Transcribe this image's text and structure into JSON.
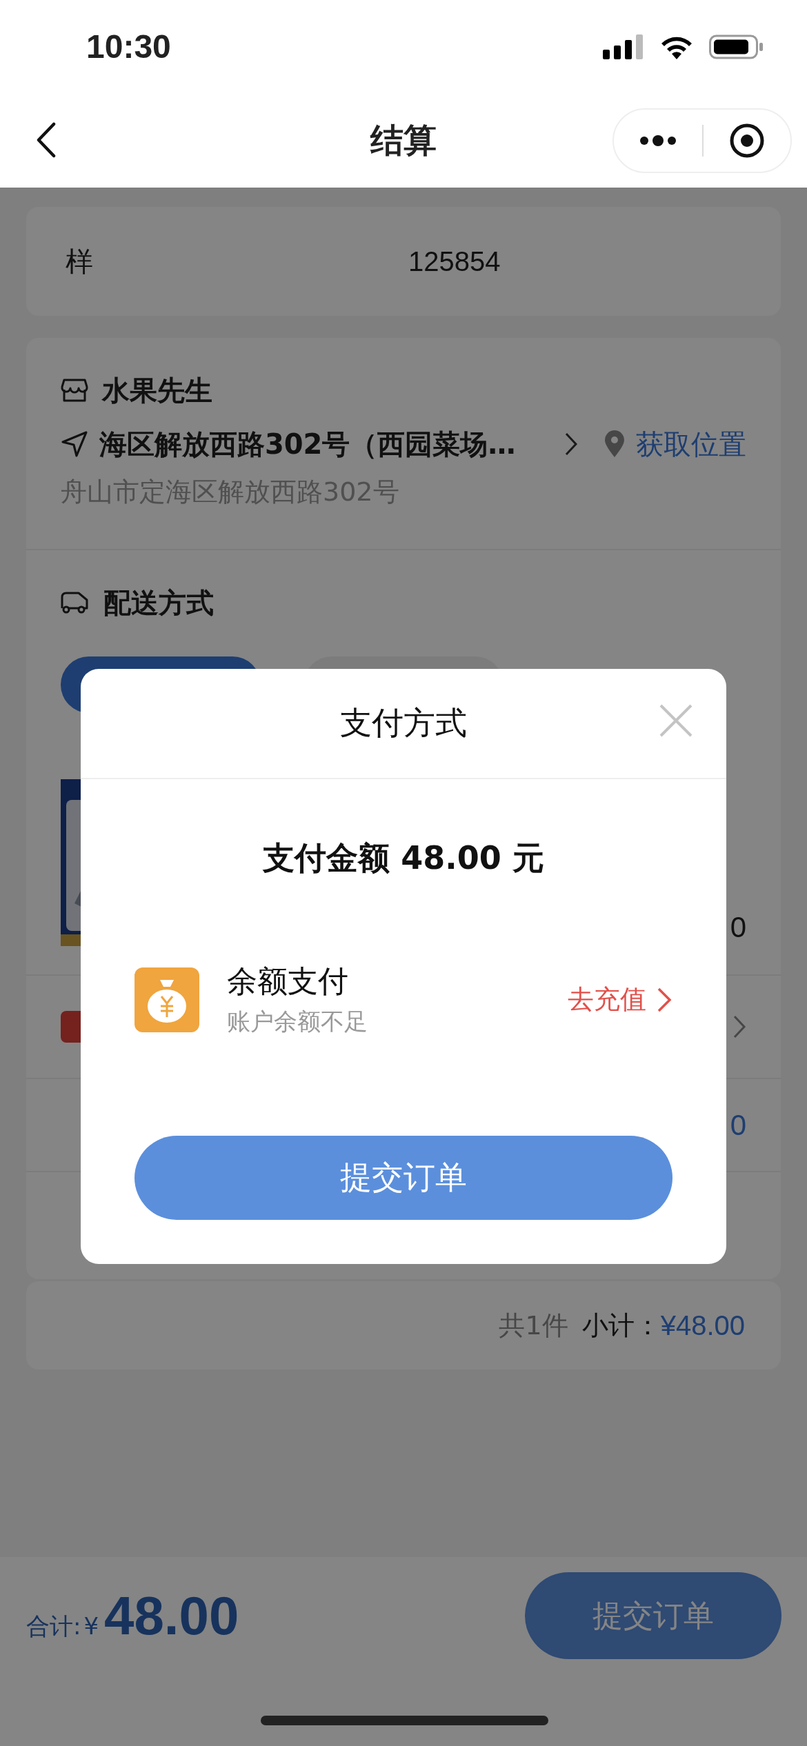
{
  "status_bar": {
    "time": "10:30"
  },
  "nav": {
    "title": "结算"
  },
  "code_card": {
    "label": "样",
    "value": "125854"
  },
  "store": {
    "name": "水果先生",
    "address": "海区解放西路302号（西园菜场…",
    "locate_link": "获取位置",
    "detail_address": "舟山市定海区解放西路302号"
  },
  "delivery": {
    "title": "配送方式",
    "options": [
      {
        "selected": true
      },
      {
        "selected": false
      }
    ]
  },
  "rows": [
    {
      "kind": "product",
      "value": "0"
    },
    {
      "kind": "discount"
    },
    {
      "kind": "fee",
      "value": "0"
    },
    {
      "kind": "note"
    }
  ],
  "subtotal": {
    "count": "共1件",
    "label": "小计：",
    "amount": "¥48.00"
  },
  "footer": {
    "total_label": "合计:",
    "currency": "¥",
    "total": "48.00",
    "button": "提交订单"
  },
  "dialog": {
    "title": "支付方式",
    "amount_text": "支付金额 48.00 元",
    "methods": [
      {
        "name": "余额支付",
        "note": "账户余额不足",
        "action": "去充值"
      }
    ],
    "submit": "提交订单"
  }
}
